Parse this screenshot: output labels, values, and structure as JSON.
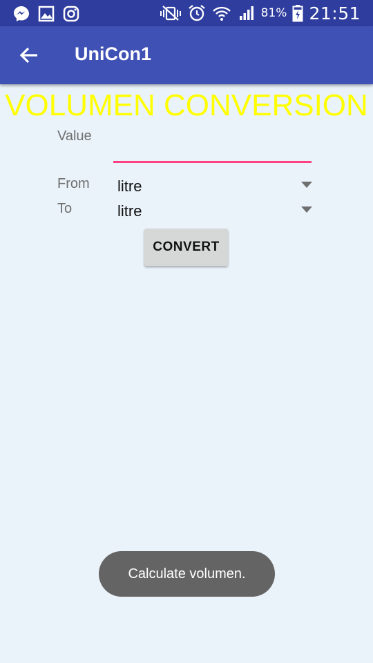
{
  "status_bar": {
    "left_icons": [
      "messenger-icon",
      "gallery-icon",
      "instagram-icon"
    ],
    "right_icons": [
      "vibrate-icon",
      "alarm-icon",
      "wifi-icon",
      "signal-icon",
      "battery-charging-icon"
    ],
    "battery": "81%",
    "time": "21:51"
  },
  "app_bar": {
    "title": "UniCon1",
    "back_icon": "arrow-back-icon"
  },
  "main": {
    "heading": "VOLUMEN CONVERSION",
    "value_label": "Value",
    "value": "",
    "from_label": "From",
    "from_selected": "litre",
    "to_label": "To",
    "to_selected": "litre",
    "convert_label": "CONVERT"
  },
  "toast": {
    "message": "Calculate volumen."
  },
  "colors": {
    "status_bar": "#2f3e9e",
    "app_bar": "#3f51b5",
    "background": "#eaf2fa",
    "heading": "#ffff00",
    "accent": "#ff4081",
    "toast": "#646464"
  }
}
